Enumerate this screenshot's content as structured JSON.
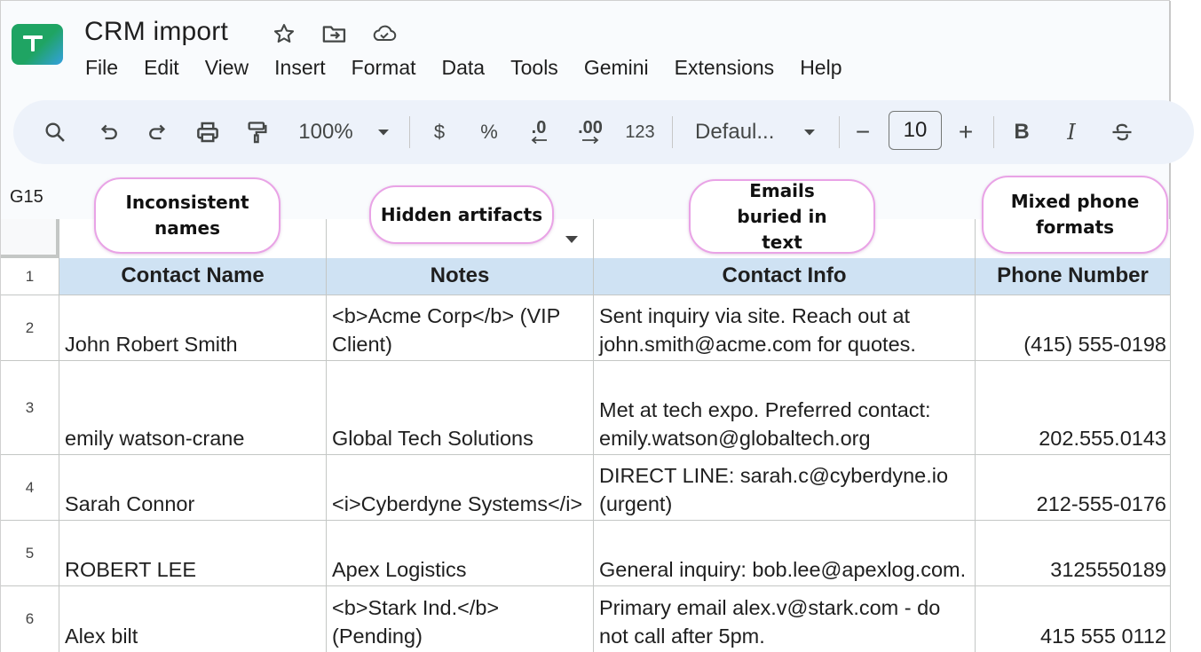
{
  "app": {
    "title": "CRM import",
    "icons": [
      "star-icon",
      "move-to-folder-icon",
      "cloud-saved-icon"
    ],
    "menu": [
      "File",
      "Edit",
      "View",
      "Insert",
      "Format",
      "Data",
      "Tools",
      "Gemini",
      "Extensions",
      "Help"
    ]
  },
  "toolbar": {
    "zoom": "100%",
    "currency": "$",
    "percent": "%",
    "decrease_decimal": ".0",
    "increase_decimal": ".00",
    "number_format": "123",
    "font": "Defaul...",
    "minus": "−",
    "font_size": "10",
    "plus": "+",
    "bold": "B",
    "italic": "I"
  },
  "name_box": "G15",
  "callouts": {
    "names": "Inconsistent names",
    "artifacts": "Hidden artifacts",
    "emails": "Emails buried in text",
    "phones": "Mixed phone formats"
  },
  "sheet": {
    "headers": [
      "Contact Name",
      "Notes",
      "Contact Info",
      "Phone Number"
    ],
    "rows": [
      {
        "num": "1"
      },
      {
        "num": "2",
        "name": "John Robert Smith",
        "notes": "<b>Acme Corp</b> (VIP Client)",
        "info": "Sent inquiry via site. Reach out at john.smith@acme.com for quotes.",
        "phone": "(415) 555-0198"
      },
      {
        "num": "3",
        "name": "emily watson-crane",
        "notes": "Global Tech Solutions",
        "info": "Met at tech expo. Preferred contact: emily.watson@globaltech.org",
        "phone": "202.555.0143"
      },
      {
        "num": "4",
        "name": "Sarah Connor",
        "notes": "<i>Cyberdyne Systems</i>",
        "info": "DIRECT LINE: sarah.c@cyberdyne.io (urgent)",
        "phone": "212-555-0176"
      },
      {
        "num": "5",
        "name": "ROBERT LEE",
        "notes": "Apex Logistics",
        "info": "General inquiry: bob.lee@apexlog.com.",
        "phone": "3125550189"
      },
      {
        "num": "6",
        "name": "Alex bilt",
        "notes": "<b>Stark Ind.</b> (Pending)",
        "info": "Primary email alex.v@stark.com - do not call after 5pm.",
        "phone": "415 555 0112"
      }
    ]
  }
}
